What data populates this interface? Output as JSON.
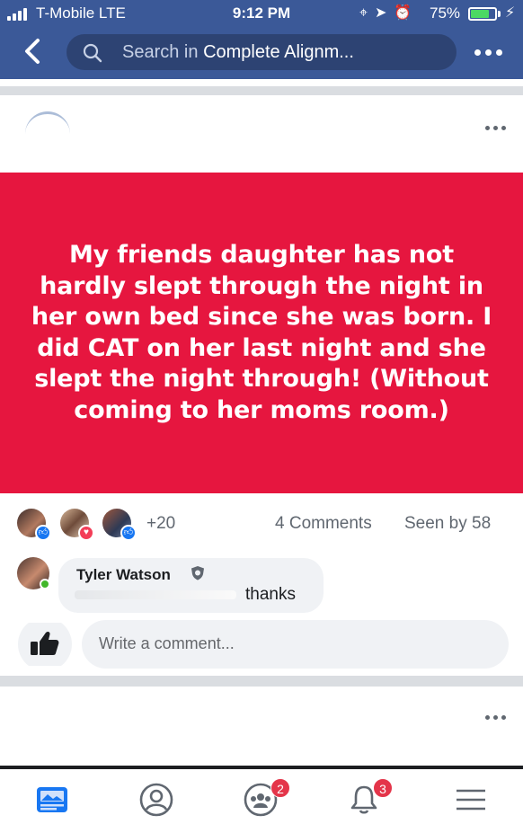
{
  "status_bar": {
    "carrier": "T-Mobile  LTE",
    "time": "9:12 PM",
    "battery": "75%",
    "battery_level": 0.75
  },
  "header": {
    "search_prefix": "Search in ",
    "search_group": "Complete Alignm..."
  },
  "post": {
    "background_color": "#e6163f",
    "text": "My friends daughter has not hardly slept through the night in her own bed since she was born. I did CAT on her last night and she slept the night through! (Without coming to her moms room.)",
    "reactions_more": "+20",
    "comments_count": "4 Comments",
    "seen_by": "Seen by 58"
  },
  "comment": {
    "author": "Tyler Watson",
    "text": "thanks"
  },
  "composer": {
    "placeholder": "Write a comment..."
  },
  "tabbar": {
    "groups_badge": "2",
    "notifications_badge": "3"
  }
}
